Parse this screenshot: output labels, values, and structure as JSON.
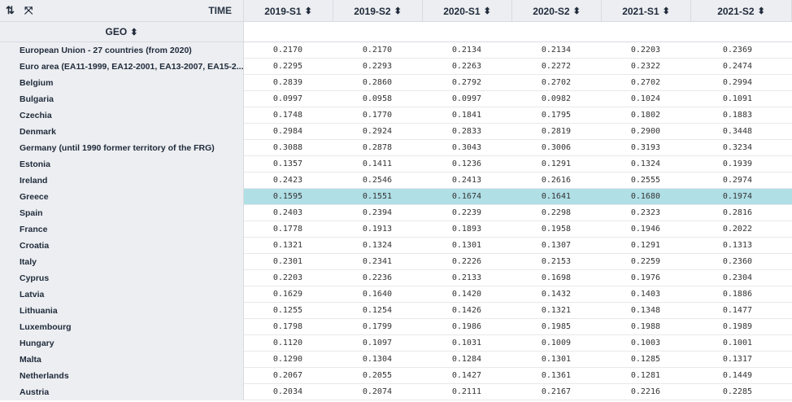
{
  "header": {
    "sort_icon": "sort-arrows-icon",
    "expand_icon": "expand-icon",
    "time_label": "TIME",
    "geo_label": "GEO",
    "sort_glyph": "⬍"
  },
  "columns": [
    "2019-S1",
    "2019-S2",
    "2020-S1",
    "2020-S2",
    "2021-S1",
    "2021-S2"
  ],
  "highlight_row": "Greece",
  "rows": [
    {
      "geo": "European Union - 27 countries (from 2020)",
      "values": [
        "0.2170",
        "0.2170",
        "0.2134",
        "0.2134",
        "0.2203",
        "0.2369"
      ]
    },
    {
      "geo": "Euro area (EA11-1999, EA12-2001, EA13-2007, EA15-2...",
      "values": [
        "0.2295",
        "0.2293",
        "0.2263",
        "0.2272",
        "0.2322",
        "0.2474"
      ]
    },
    {
      "geo": "Belgium",
      "values": [
        "0.2839",
        "0.2860",
        "0.2792",
        "0.2702",
        "0.2702",
        "0.2994"
      ]
    },
    {
      "geo": "Bulgaria",
      "values": [
        "0.0997",
        "0.0958",
        "0.0997",
        "0.0982",
        "0.1024",
        "0.1091"
      ]
    },
    {
      "geo": "Czechia",
      "values": [
        "0.1748",
        "0.1770",
        "0.1841",
        "0.1795",
        "0.1802",
        "0.1883"
      ]
    },
    {
      "geo": "Denmark",
      "values": [
        "0.2984",
        "0.2924",
        "0.2833",
        "0.2819",
        "0.2900",
        "0.3448"
      ]
    },
    {
      "geo": "Germany (until 1990 former territory of the FRG)",
      "values": [
        "0.3088",
        "0.2878",
        "0.3043",
        "0.3006",
        "0.3193",
        "0.3234"
      ]
    },
    {
      "geo": "Estonia",
      "values": [
        "0.1357",
        "0.1411",
        "0.1236",
        "0.1291",
        "0.1324",
        "0.1939"
      ]
    },
    {
      "geo": "Ireland",
      "values": [
        "0.2423",
        "0.2546",
        "0.2413",
        "0.2616",
        "0.2555",
        "0.2974"
      ]
    },
    {
      "geo": "Greece",
      "values": [
        "0.1595",
        "0.1551",
        "0.1674",
        "0.1641",
        "0.1680",
        "0.1974"
      ]
    },
    {
      "geo": "Spain",
      "values": [
        "0.2403",
        "0.2394",
        "0.2239",
        "0.2298",
        "0.2323",
        "0.2816"
      ]
    },
    {
      "geo": "France",
      "values": [
        "0.1778",
        "0.1913",
        "0.1893",
        "0.1958",
        "0.1946",
        "0.2022"
      ]
    },
    {
      "geo": "Croatia",
      "values": [
        "0.1321",
        "0.1324",
        "0.1301",
        "0.1307",
        "0.1291",
        "0.1313"
      ]
    },
    {
      "geo": "Italy",
      "values": [
        "0.2301",
        "0.2341",
        "0.2226",
        "0.2153",
        "0.2259",
        "0.2360"
      ]
    },
    {
      "geo": "Cyprus",
      "values": [
        "0.2203",
        "0.2236",
        "0.2133",
        "0.1698",
        "0.1976",
        "0.2304"
      ]
    },
    {
      "geo": "Latvia",
      "values": [
        "0.1629",
        "0.1640",
        "0.1420",
        "0.1432",
        "0.1403",
        "0.1886"
      ]
    },
    {
      "geo": "Lithuania",
      "values": [
        "0.1255",
        "0.1254",
        "0.1426",
        "0.1321",
        "0.1348",
        "0.1477"
      ]
    },
    {
      "geo": "Luxembourg",
      "values": [
        "0.1798",
        "0.1799",
        "0.1986",
        "0.1985",
        "0.1988",
        "0.1989"
      ]
    },
    {
      "geo": "Hungary",
      "values": [
        "0.1120",
        "0.1097",
        "0.1031",
        "0.1009",
        "0.1003",
        "0.1001"
      ]
    },
    {
      "geo": "Malta",
      "values": [
        "0.1290",
        "0.1304",
        "0.1284",
        "0.1301",
        "0.1285",
        "0.1317"
      ]
    },
    {
      "geo": "Netherlands",
      "values": [
        "0.2067",
        "0.2055",
        "0.1427",
        "0.1361",
        "0.1281",
        "0.1449"
      ]
    },
    {
      "geo": "Austria",
      "values": [
        "0.2034",
        "0.2074",
        "0.2111",
        "0.2167",
        "0.2216",
        "0.2285"
      ]
    }
  ]
}
